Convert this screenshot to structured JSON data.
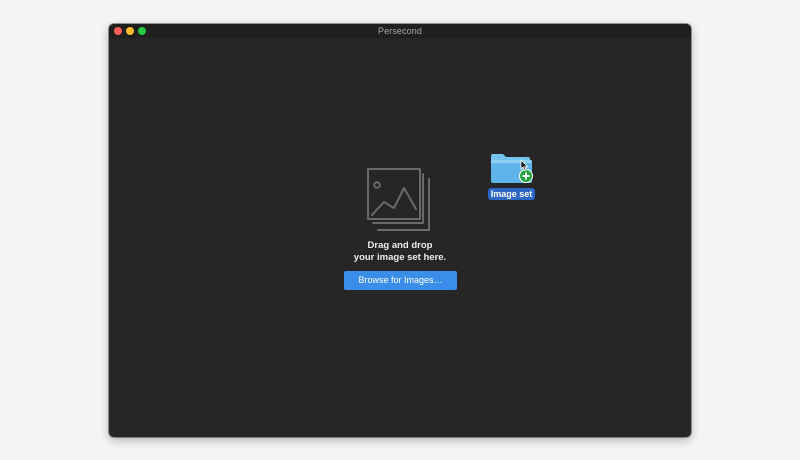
{
  "window": {
    "title": "Persecond",
    "controls": {
      "close_icon": "close-icon",
      "minimize_icon": "minimize-icon",
      "zoom_icon": "zoom-icon"
    }
  },
  "dropzone": {
    "icon": "image-stack-icon",
    "instruction_line1": "Drag and drop",
    "instruction_line2": "your image set here.",
    "browse_label": "Browse for Images…"
  },
  "desktop_item": {
    "icon": "folder-add-icon",
    "label": "Image set"
  },
  "colors": {
    "window_bg": "#262626",
    "title_bar_bg": "#1f1f1f",
    "accent": "#3a8ee9",
    "selection": "#2c67c7",
    "close": "#fc5f57",
    "minimize": "#fdbc2e",
    "zoom": "#28c840"
  }
}
